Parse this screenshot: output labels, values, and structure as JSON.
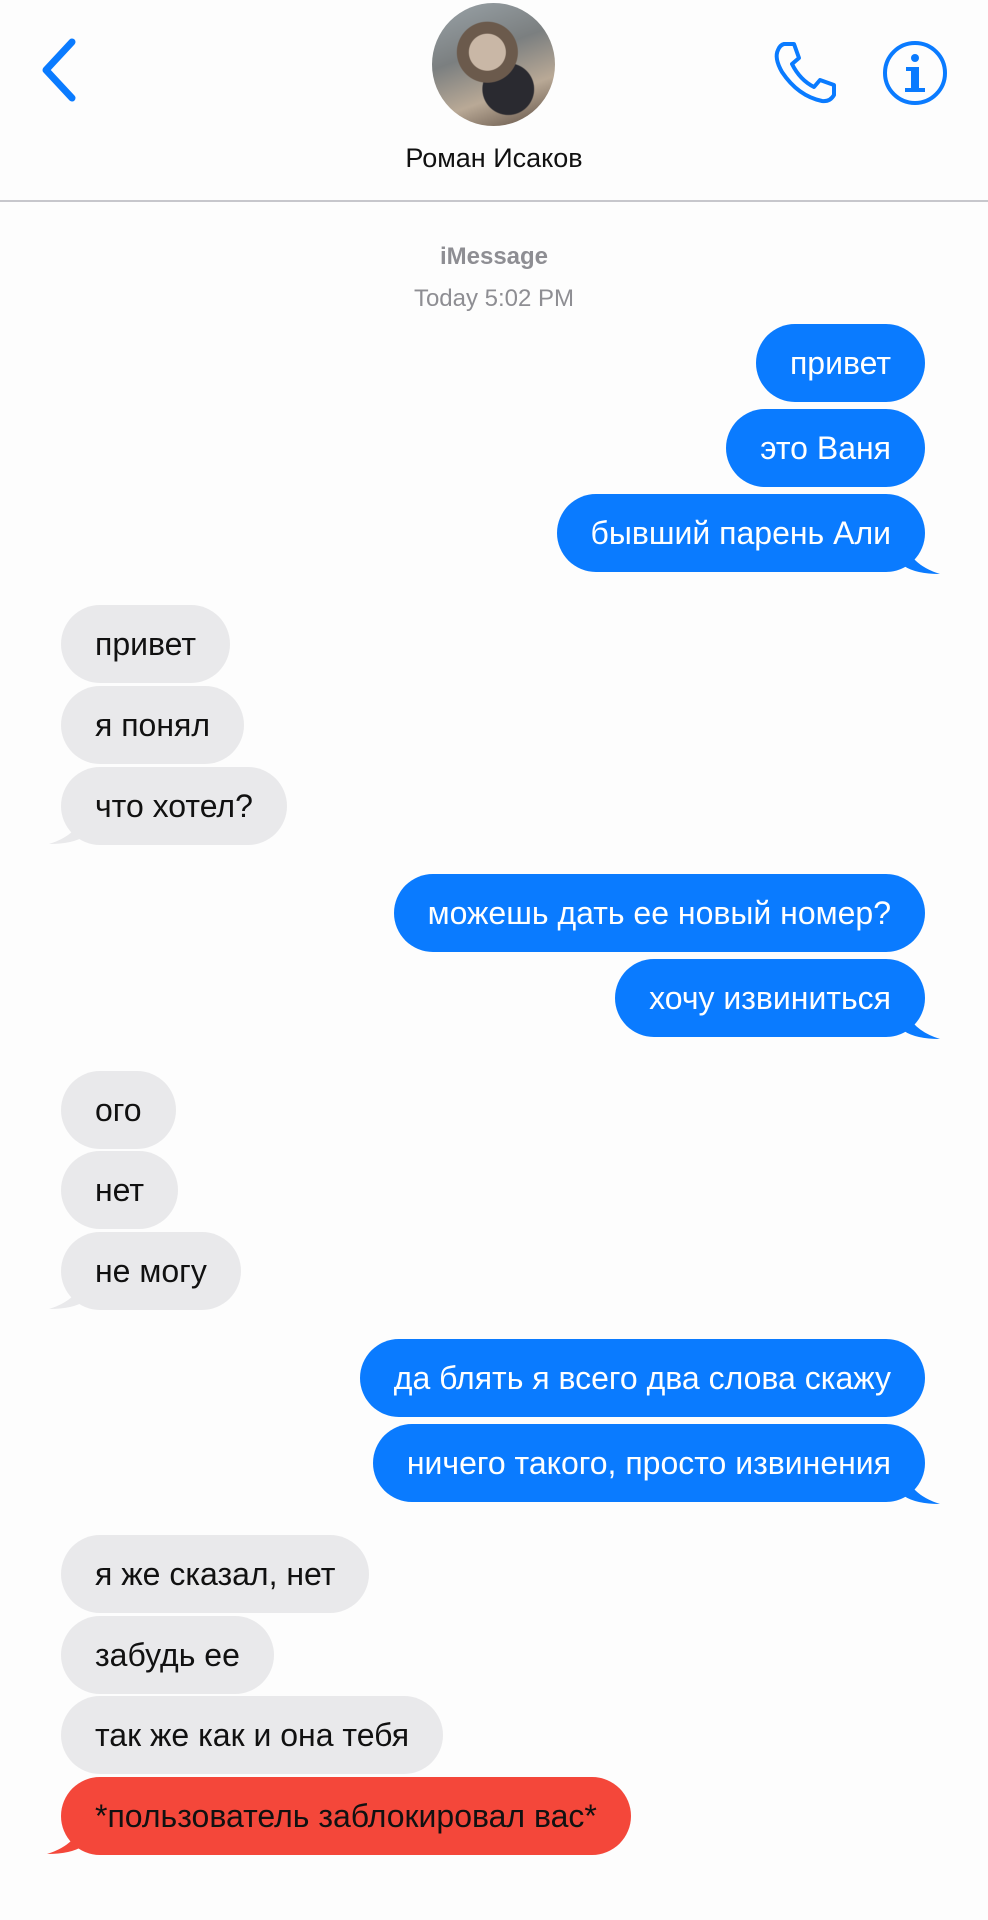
{
  "header": {
    "contact_name": "Роман Исаков"
  },
  "conversation": {
    "service": "iMessage",
    "timestamp": "Today 5:02 PM"
  },
  "messages": [
    {
      "text": "привет",
      "direction": "outgoing"
    },
    {
      "text": "это Ваня",
      "direction": "outgoing"
    },
    {
      "text": "бывший парень Али",
      "direction": "outgoing"
    },
    {
      "text": "привет",
      "direction": "incoming"
    },
    {
      "text": "я понял",
      "direction": "incoming"
    },
    {
      "text": "что хотел?",
      "direction": "incoming"
    },
    {
      "text": "можешь дать ее новый номер?",
      "direction": "outgoing"
    },
    {
      "text": "хочу извиниться",
      "direction": "outgoing"
    },
    {
      "text": "ого",
      "direction": "incoming"
    },
    {
      "text": "нет",
      "direction": "incoming"
    },
    {
      "text": "не могу",
      "direction": "incoming"
    },
    {
      "text": "да блять я всего два слова скажу",
      "direction": "outgoing"
    },
    {
      "text": "ничего такого, просто извинения",
      "direction": "outgoing"
    },
    {
      "text": "я же сказал, нет",
      "direction": "incoming"
    },
    {
      "text": "забудь ее",
      "direction": "incoming"
    },
    {
      "text": "так же как и она тебя",
      "direction": "incoming"
    },
    {
      "text": "*пользователь заблокировал вас*",
      "direction": "incoming",
      "style": "blocked"
    }
  ],
  "colors": {
    "accent": "#0a7bff",
    "incoming_bubble": "#e9e9eb",
    "blocked_bubble": "#f4473a",
    "meta_text": "#8e8e93"
  },
  "icons": [
    "chevron-left-icon",
    "phone-icon",
    "info-icon"
  ]
}
